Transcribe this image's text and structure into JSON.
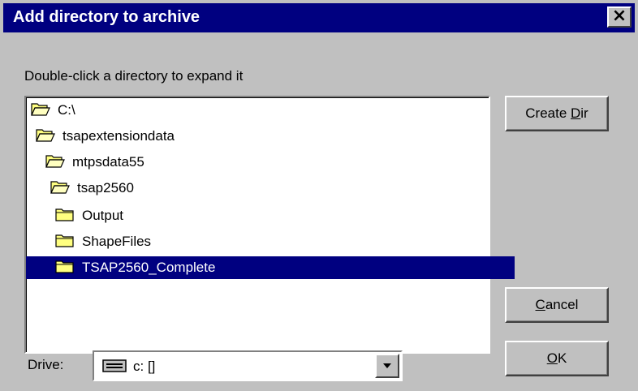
{
  "window": {
    "title": "Add directory to archive",
    "close_icon": "close-icon"
  },
  "instruction": "Double-click a directory to expand it",
  "tree": [
    {
      "label": "C:\\",
      "icon": "open-folder-icon",
      "selected": false
    },
    {
      "label": "tsapextensiondata",
      "icon": "open-folder-icon",
      "selected": false
    },
    {
      "label": "mtpsdata55",
      "icon": "open-folder-icon",
      "selected": false
    },
    {
      "label": "tsap2560",
      "icon": "open-folder-icon",
      "selected": false
    },
    {
      "label": "Output",
      "icon": "folder-icon",
      "selected": false
    },
    {
      "label": "ShapeFiles",
      "icon": "folder-icon",
      "selected": false
    },
    {
      "label": "TSAP2560_Complete",
      "icon": "folder-icon",
      "selected": true
    }
  ],
  "buttons": {
    "create_dir": {
      "label": "Create Dir",
      "accel": "D"
    },
    "cancel": {
      "label": "Cancel",
      "accel": "C"
    },
    "ok": {
      "label": "OK",
      "accel": "O"
    }
  },
  "drive": {
    "label": "Drive:",
    "value": "c: []",
    "icon": "drive-icon"
  },
  "colors": {
    "titlebar": "#000080",
    "selection": "#000080",
    "face": "#c0c0c0"
  }
}
